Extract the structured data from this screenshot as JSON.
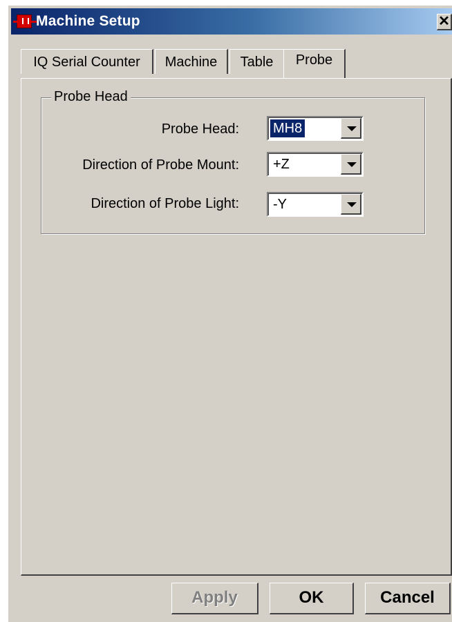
{
  "window": {
    "title": "Machine Setup",
    "close_label": "✕"
  },
  "tabs": [
    {
      "label": "IQ Serial Counter",
      "active": false
    },
    {
      "label": "Machine",
      "active": false
    },
    {
      "label": "Table",
      "active": false
    },
    {
      "label": "Probe",
      "active": true
    }
  ],
  "group": {
    "title": "Probe Head",
    "fields": [
      {
        "label": "Probe Head:",
        "value": "MH8"
      },
      {
        "label": "Direction of Probe Mount:",
        "value": "+Z"
      },
      {
        "label": "Direction of Probe Light:",
        "value": "-Y"
      }
    ]
  },
  "buttons": {
    "apply": "Apply",
    "ok": "OK",
    "cancel": "Cancel"
  },
  "icons": {
    "app": "machine-app-icon",
    "dropdown": "chevron-down-icon"
  },
  "colors": {
    "titlebar_start": "#0a246a",
    "titlebar_end": "#a6caf0",
    "dialog_bg": "#d4d0c8",
    "selection": "#0a246a"
  }
}
